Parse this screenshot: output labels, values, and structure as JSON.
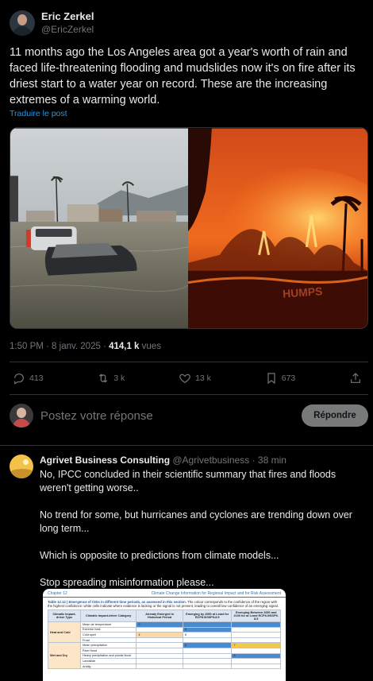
{
  "tweet": {
    "author": {
      "display_name": "Eric Zerkel",
      "handle": "@EricZerkel"
    },
    "text": "11 months ago the Los Angeles area got a year's worth of rain and faced life-threatening flooding and mudslides now it's on fire after its driest start to a water year on record. These are the increasing extremes of a warming world.",
    "translate_label": "Traduire le post",
    "media_left_icon": "flooded-street-photo",
    "media_right_icon": "wildfire-photo",
    "media_right_road_text": "HUMPS",
    "timestamp": "1:50 PM · 8 janv. 2025 · ",
    "views_count": "414,1 k",
    "views_label": " vues",
    "stats": {
      "replies": "413",
      "reposts": "3 k",
      "likes": "13 k",
      "bookmarks": "673"
    }
  },
  "reply_composer": {
    "placeholder": "Postez votre réponse",
    "button_label": "Répondre"
  },
  "reply": {
    "display_name": "Agrivet Business Consulting",
    "handle": "@Agrivetbusiness",
    "time": " · 38 min",
    "paragraphs": [
      "No, IPCC concluded in their scientific summary that fires and floods weren't getting worse..",
      "No trend for some, but hurricanes and cyclones are trending down over long term...",
      "Which is opposite to predictions from climate models...",
      "Stop spreading misinformation please..."
    ],
    "attached_doc": {
      "chapter": "Chapter 12",
      "header_right": "Climate Change Information for Regional Impact and for Risk Assessment",
      "caption_bold": "Table 12.12 | Emergence of CIDs in different time periods, as assessed in this section.",
      "caption_rest": " The colour corresponds to the confidence of the region with the highest confidence: white cells indicate where evidence is lacking or the signal is not present, leading to overall low confidence of an emerging signal.",
      "columns": [
        "Climatic Impact-driver Type",
        "Climatic Impact-driver Category",
        "Already Emerged in Historical Period",
        "Emerging by 2050 at Least for RCP8.5/SSP5-8.5",
        "Emerging Between 2050 and 2100 for at Least RCP8.5/SSP5-8.5"
      ],
      "groups": [
        "Heat and Cold",
        "Wet and Dry"
      ],
      "rows": [
        "Mean air temperature",
        "Extreme heat",
        "Cold spell",
        "Frost",
        "Mean precipitation",
        "River flood",
        "Heavy precipitation and pluvial flood",
        "Landslide",
        "Aridity"
      ],
      "cell_numbers": [
        "2",
        "3",
        "4",
        "5",
        "6",
        "7",
        "8"
      ]
    }
  }
}
